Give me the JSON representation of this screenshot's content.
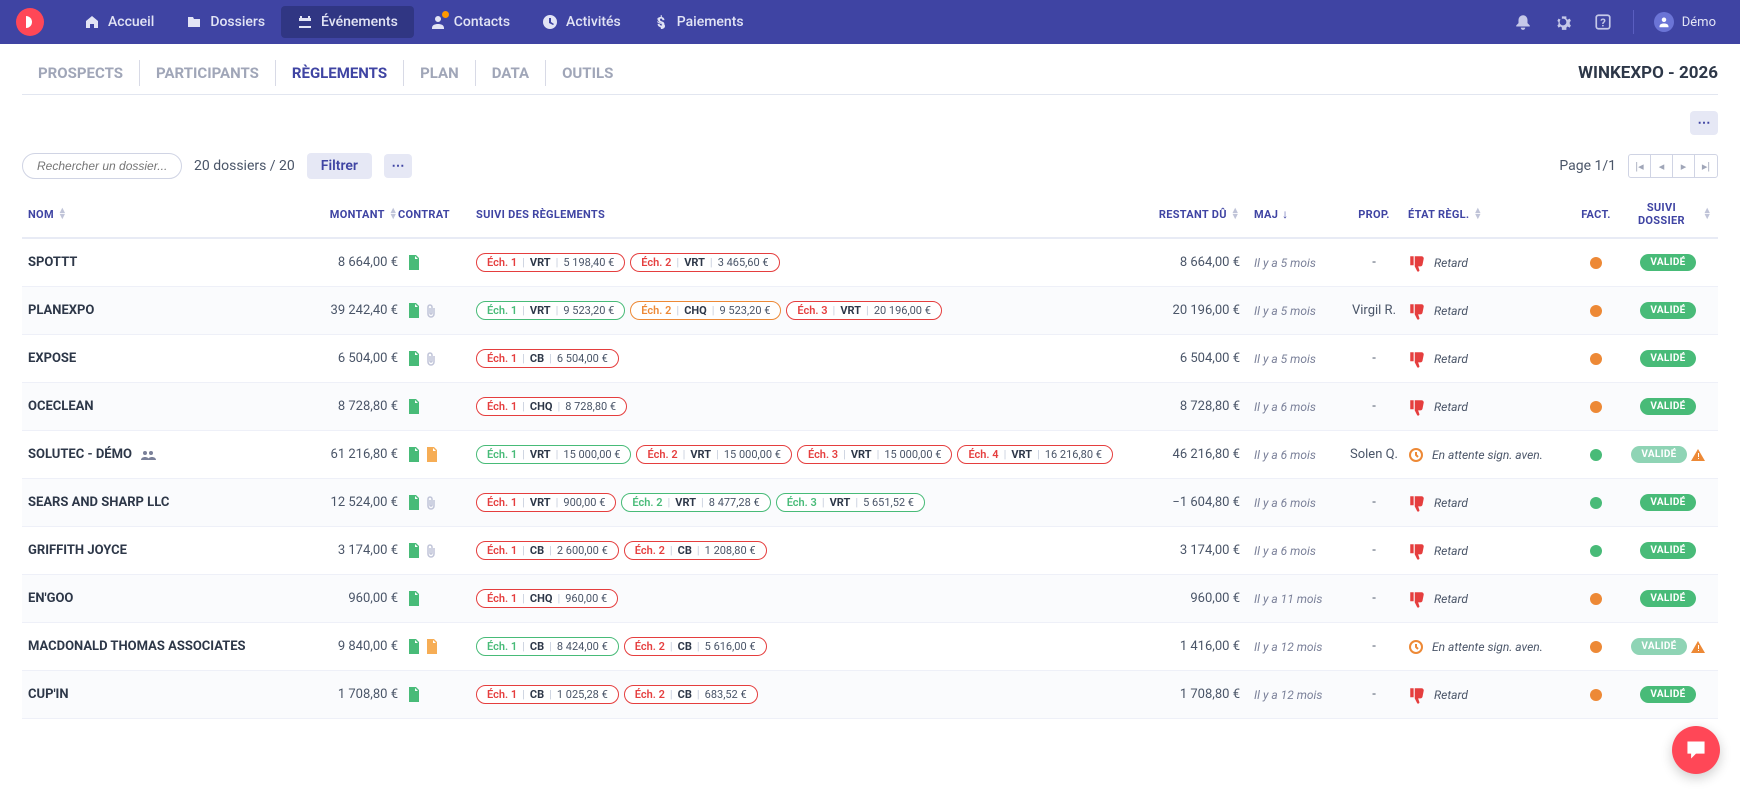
{
  "nav": {
    "items": [
      {
        "label": "Accueil",
        "icon": "home"
      },
      {
        "label": "Dossiers",
        "icon": "folder"
      },
      {
        "label": "Événements",
        "icon": "calendar",
        "active": true
      },
      {
        "label": "Contacts",
        "icon": "user"
      },
      {
        "label": "Activités",
        "icon": "clock"
      },
      {
        "label": "Paiements",
        "icon": "dollar"
      }
    ],
    "user": "Démo"
  },
  "subnav": {
    "tabs": [
      "PROSPECTS",
      "PARTICIPANTS",
      "RÈGLEMENTS",
      "PLAN",
      "DATA",
      "OUTILS"
    ],
    "active": "RÈGLEMENTS",
    "event_title": "WINKEXPO - 2026"
  },
  "toolbar": {
    "search_placeholder": "Rechercher un dossier...",
    "count": "20 dossiers / 20",
    "filter_label": "Filtrer",
    "page_label": "Page 1/1"
  },
  "columns": {
    "nom": "NOM",
    "montant": "MONTANT",
    "contrat": "CONTRAT",
    "suivi": "SUIVI DES RÈGLEMENTS",
    "restant": "RESTANT DÛ",
    "maj": "MAJ",
    "prop": "PROP.",
    "etat": "ÉTAT RÈGL.",
    "fact": "FACT.",
    "stat": "SUIVI DOSSIER"
  },
  "rows": [
    {
      "nom": "SPOTTT",
      "montant": "8 664,00 €",
      "docs": [
        "green"
      ],
      "echs": [
        {
          "c": "red",
          "l": "Éch. 1",
          "t": "VRT",
          "a": "5 198,40 €"
        },
        {
          "c": "red",
          "l": "Éch. 2",
          "t": "VRT",
          "a": "3 465,60 €"
        }
      ],
      "restant": "8 664,00 €",
      "maj": "Il y a 5 mois",
      "prop": "-",
      "etat": {
        "icon": "thumb",
        "text": "Retard"
      },
      "fact": "orange",
      "badge": "VALIDÉ"
    },
    {
      "nom": "PLANEXPO",
      "montant": "39 242,40 €",
      "docs": [
        "green",
        "clip"
      ],
      "echs": [
        {
          "c": "green",
          "l": "Éch. 1",
          "t": "VRT",
          "a": "9 523,20 €"
        },
        {
          "c": "orange",
          "l": "Éch. 2",
          "t": "CHQ",
          "a": "9 523,20 €"
        },
        {
          "c": "red",
          "l": "Éch. 3",
          "t": "VRT",
          "a": "20 196,00 €"
        }
      ],
      "restant": "20 196,00 €",
      "maj": "Il y a 5 mois",
      "prop": "Virgil R.",
      "etat": {
        "icon": "thumb",
        "text": "Retard"
      },
      "fact": "orange",
      "badge": "VALIDÉ"
    },
    {
      "nom": "EXPOSE",
      "montant": "6 504,00 €",
      "docs": [
        "green",
        "clip"
      ],
      "echs": [
        {
          "c": "red",
          "l": "Éch. 1",
          "t": "CB",
          "a": "6 504,00 €"
        }
      ],
      "restant": "6 504,00 €",
      "maj": "Il y a 5 mois",
      "prop": "-",
      "etat": {
        "icon": "thumb",
        "text": "Retard"
      },
      "fact": "orange",
      "badge": "VALIDÉ"
    },
    {
      "nom": "OCECLEAN",
      "montant": "8 728,80 €",
      "docs": [
        "green"
      ],
      "echs": [
        {
          "c": "red",
          "l": "Éch. 1",
          "t": "CHQ",
          "a": "8 728,80 €"
        }
      ],
      "restant": "8 728,80 €",
      "maj": "Il y a 6 mois",
      "prop": "-",
      "etat": {
        "icon": "thumb",
        "text": "Retard"
      },
      "fact": "orange",
      "badge": "VALIDÉ"
    },
    {
      "nom": "SOLUTEC - DÉMO",
      "group": true,
      "montant": "61 216,80 €",
      "docs": [
        "green",
        "orange"
      ],
      "echs": [
        {
          "c": "green",
          "l": "Éch. 1",
          "t": "VRT",
          "a": "15 000,00 €"
        },
        {
          "c": "red",
          "l": "Éch. 2",
          "t": "VRT",
          "a": "15 000,00 €"
        },
        {
          "c": "red",
          "l": "Éch. 3",
          "t": "VRT",
          "a": "15 000,00 €"
        },
        {
          "c": "red",
          "l": "Éch. 4",
          "t": "VRT",
          "a": "16 216,80 €"
        }
      ],
      "restant": "46 216,80 €",
      "maj": "Il y a 6 mois",
      "prop": "Solen Q.",
      "etat": {
        "icon": "clock",
        "text": "En attente sign. aven."
      },
      "fact": "green",
      "badge": "VALIDÉ",
      "dim": true,
      "warn": true
    },
    {
      "nom": "SEARS AND SHARP LLC",
      "montant": "12 524,00 €",
      "docs": [
        "green",
        "clip"
      ],
      "echs": [
        {
          "c": "red",
          "l": "Éch. 1",
          "t": "VRT",
          "a": "900,00 €"
        },
        {
          "c": "green",
          "l": "Éch. 2",
          "t": "VRT",
          "a": "8 477,28 €"
        },
        {
          "c": "green",
          "l": "Éch. 3",
          "t": "VRT",
          "a": "5 651,52 €"
        }
      ],
      "restant": "−1 604,80 €",
      "maj": "Il y a 6 mois",
      "prop": "-",
      "etat": {
        "icon": "thumb",
        "text": "Retard"
      },
      "fact": "green",
      "badge": "VALIDÉ"
    },
    {
      "nom": "GRIFFITH JOYCE",
      "montant": "3 174,00 €",
      "docs": [
        "green",
        "clip"
      ],
      "echs": [
        {
          "c": "red",
          "l": "Éch. 1",
          "t": "CB",
          "a": "2 600,00 €"
        },
        {
          "c": "red",
          "l": "Éch. 2",
          "t": "CB",
          "a": "1 208,80 €"
        }
      ],
      "restant": "3 174,00 €",
      "maj": "Il y a 6 mois",
      "prop": "-",
      "etat": {
        "icon": "thumb",
        "text": "Retard"
      },
      "fact": "green",
      "badge": "VALIDÉ"
    },
    {
      "nom": "EN'GOO",
      "montant": "960,00 €",
      "docs": [
        "green"
      ],
      "echs": [
        {
          "c": "red",
          "l": "Éch. 1",
          "t": "CHQ",
          "a": "960,00 €"
        }
      ],
      "restant": "960,00 €",
      "maj": "Il y a 11 mois",
      "prop": "-",
      "etat": {
        "icon": "thumb",
        "text": "Retard"
      },
      "fact": "orange",
      "badge": "VALIDÉ"
    },
    {
      "nom": "MACDONALD THOMAS ASSOCIATES",
      "montant": "9 840,00 €",
      "docs": [
        "green",
        "orange"
      ],
      "echs": [
        {
          "c": "green",
          "l": "Éch. 1",
          "t": "CB",
          "a": "8 424,00 €"
        },
        {
          "c": "red",
          "l": "Éch. 2",
          "t": "CB",
          "a": "5 616,00 €"
        }
      ],
      "restant": "1 416,00 €",
      "maj": "Il y a 12 mois",
      "prop": "-",
      "etat": {
        "icon": "clock",
        "text": "En attente sign. aven."
      },
      "fact": "orange",
      "badge": "VALIDÉ",
      "dim": true,
      "warn": true
    },
    {
      "nom": "CUP'IN",
      "montant": "1 708,80 €",
      "docs": [
        "green"
      ],
      "echs": [
        {
          "c": "red",
          "l": "Éch. 1",
          "t": "CB",
          "a": "1 025,28 €"
        },
        {
          "c": "red",
          "l": "Éch. 2",
          "t": "CB",
          "a": "683,52 €"
        }
      ],
      "restant": "1 708,80 €",
      "maj": "Il y a 12 mois",
      "prop": "-",
      "etat": {
        "icon": "thumb",
        "text": "Retard"
      },
      "fact": "orange",
      "badge": "VALIDÉ"
    }
  ]
}
